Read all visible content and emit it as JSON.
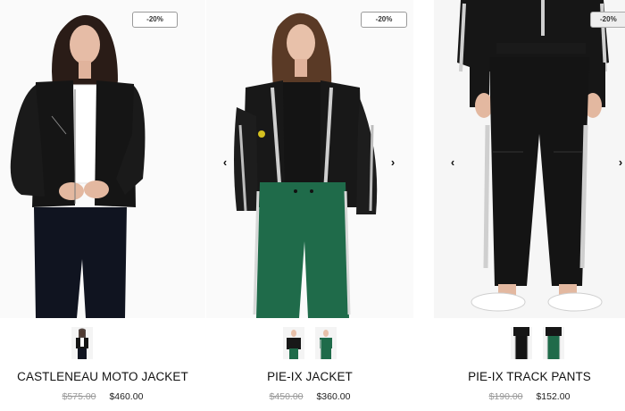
{
  "products": [
    {
      "badge": "-20%",
      "name": "CASTLENEAU MOTO JACKET",
      "old_price": "$575.00",
      "new_price": "$460.00",
      "thumbnails": [
        "black-jacket-thumb"
      ]
    },
    {
      "badge": "-20%",
      "name": "PIE-IX JACKET",
      "old_price": "$450.00",
      "new_price": "$360.00",
      "thumbnails": [
        "black-jacket-thumb",
        "green-pants-thumb"
      ]
    },
    {
      "badge": "-20%",
      "name": "PIE-IX TRACK PANTS",
      "old_price": "$190.00",
      "new_price": "$152.00",
      "thumbnails": [
        "black-pants-thumb",
        "green-pants-thumb"
      ]
    }
  ],
  "carousel": {
    "prev_glyph": "‹",
    "next_glyph": "›"
  },
  "colors": {
    "jacket": "#151515",
    "green": "#1f6b4a",
    "skin": "#e3b8a0",
    "hair": "#2a1c17",
    "shirt": "#ffffff",
    "old_price": "#999999"
  }
}
